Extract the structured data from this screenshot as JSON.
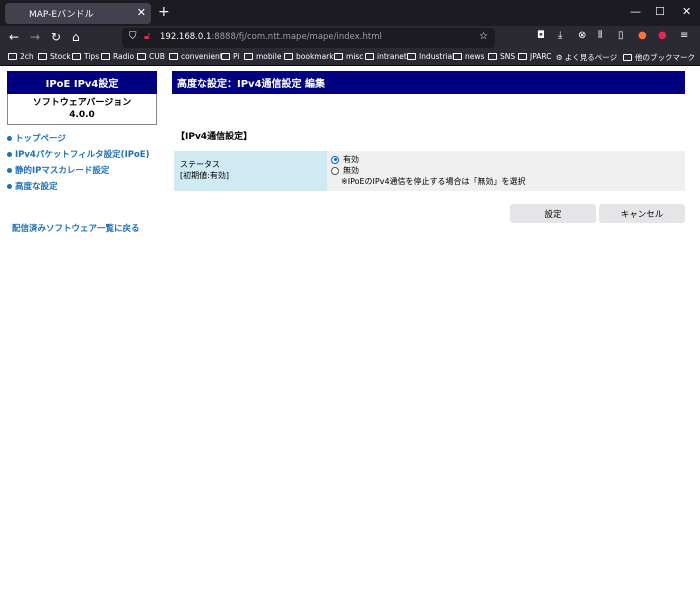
{
  "tab": {
    "title": "MAP-Eバンドル"
  },
  "nav": {
    "url_host": "192.168.0.1",
    "url_rest": ":8888/fj/com.ntt.mape/mape/index.html"
  },
  "bookmarks": [
    "2ch",
    "Stock",
    "Tips",
    "Radio",
    "CUB",
    "convenient",
    "Pi",
    "mobile",
    "bookmark",
    "misc",
    "intranet",
    "Industrial",
    "news",
    "SNS",
    "JPARC",
    "よく見るページ",
    "他のブックマーク"
  ],
  "sidebar": {
    "header": "IPoE IPv4設定",
    "version_label": "ソフトウェアバージョン",
    "version_value": "4.0.0",
    "links": [
      "トップページ",
      "IPv4パケットフィルタ設定(IPoE)",
      "静的IPマスカレード設定",
      "高度な設定"
    ],
    "back_link": "配信済みソフトウェア一覧に戻る"
  },
  "main": {
    "header": "高度な設定：IPv4通信設定 編集",
    "section_title": "【IPv4通信設定】",
    "row_label": "ステータス",
    "row_default": "[初期値:有効]",
    "option_on": "有効",
    "option_off": "無効",
    "note": "※IPoEのIPv4通信を停止する場合は「無効」を選択",
    "save_label": "設定",
    "cancel_label": "キャンセル"
  },
  "colors": {
    "header_bg": "#000080",
    "link": "#1e6fb5",
    "label_bg": "#cfeaf3"
  }
}
